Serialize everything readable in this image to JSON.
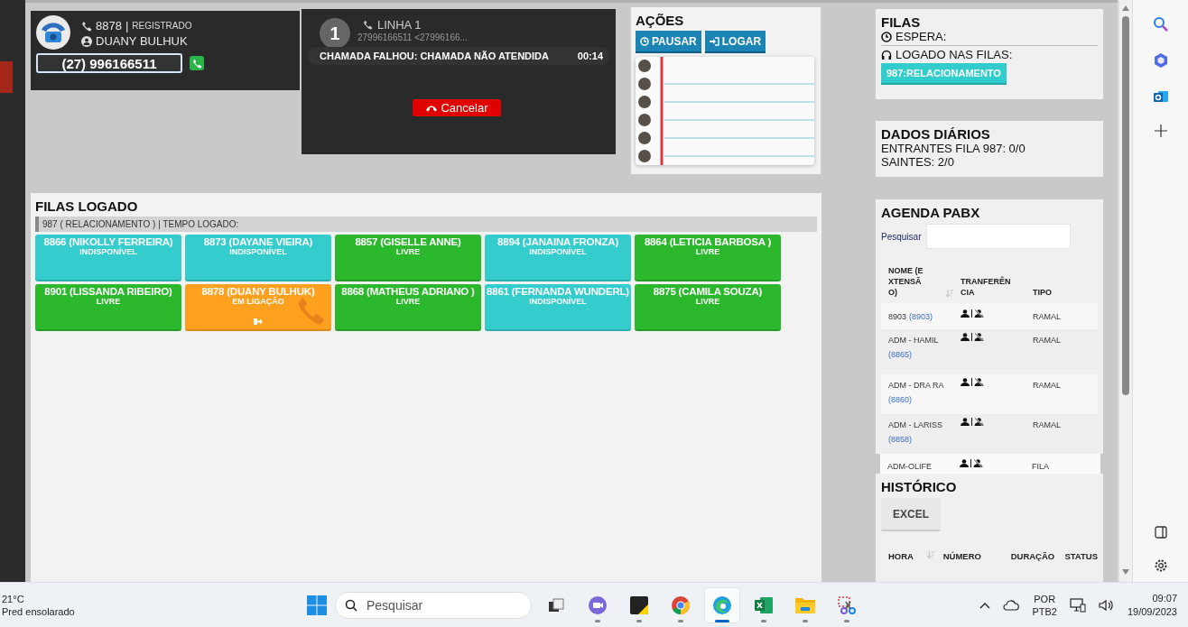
{
  "phone": {
    "extension": "8878",
    "separator": "|",
    "reg_status": "REGISTRADO",
    "user": "DUANY BULHUK",
    "dial_value": "(27) 996166511"
  },
  "call": {
    "line_number": "1",
    "line_label": "LINHA 1",
    "caller": "27996166511 <27996166...",
    "status": "CHAMADA FALHOU: CHAMADA NÃO ATENDIDA",
    "duration": "00:14",
    "cancel": "Cancelar"
  },
  "actions": {
    "title": "AÇÕES",
    "buttons": [
      {
        "kind": "pause",
        "label": "PAUSAR"
      },
      {
        "kind": "login",
        "label": "LOGAR"
      }
    ]
  },
  "queues": {
    "title": "FILAS",
    "waiting": "ESPERA:",
    "logged": "LOGADO NAS FILAS:",
    "tags": [
      "987:RELACIONAMENTO"
    ]
  },
  "daily": {
    "title": "DADOS DIÁRIOS",
    "lines": [
      "ENTRANTES FILA 987: 0/0",
      "SAINTES: 2/0"
    ]
  },
  "queue_panel": {
    "title": "FILAS LOGADO",
    "subheader": "987 ( RELACIONAMENTO ) | TEMPO LOGADO:",
    "agents": [
      {
        "name": "8866 (NIKOLLY FERREIRA)",
        "status": "INDISPONÍVEL",
        "kind": "unavailable"
      },
      {
        "name": "8873 (DAYANE VIEIRA)",
        "status": "INDISPONÍVEL",
        "kind": "unavailable"
      },
      {
        "name": "8857 (GISELLE ANNE)",
        "status": "LIVRE",
        "kind": "free"
      },
      {
        "name": "8894 (JANAINA FRONZA)",
        "status": "INDISPONÍVEL",
        "kind": "unavailable"
      },
      {
        "name": "8864 (LETICIA BARBOSA )",
        "status": "LIVRE",
        "kind": "free"
      },
      {
        "name": "8901 (LISSANDA RIBEIRO)",
        "status": "LIVRE",
        "kind": "free"
      },
      {
        "name": "8878 (DUANY BULHUK)",
        "status": "EM LIGAÇÃO",
        "kind": "in_call"
      },
      {
        "name": "8868 (MATHEUS ADRIANO )",
        "status": "LIVRE",
        "kind": "free"
      },
      {
        "name": "8861 (FERNANDA WUNDERL)",
        "status": "INDISPONÍVEL",
        "kind": "unavailable"
      },
      {
        "name": "8875 (CAMILA SOUZA)",
        "status": "LIVRE",
        "kind": "free"
      }
    ]
  },
  "agenda": {
    "title": "AGENDA PABX",
    "search_label": "Pesquisar",
    "columns": [
      "NOME (EXTENSÃO)",
      "TRANFERÊNCIA",
      "TIPO"
    ],
    "rows": [
      {
        "name": "8903",
        "ext": "(8903)",
        "type": "RAMAL"
      },
      {
        "name": "ADM - HAMIL",
        "ext": "(8865)",
        "type": "RAMAL"
      },
      {
        "name": "ADM - DRA RA",
        "ext": "(8860)",
        "type": "RAMAL"
      },
      {
        "name": "ADM - LARISS",
        "ext": "(8858)",
        "type": "RAMAL"
      }
    ],
    "overflow_row": {
      "name": "ADM-OLIFE",
      "type": "FILA"
    }
  },
  "history": {
    "title": "HISTÓRICO",
    "excel": "EXCEL",
    "columns": [
      "HORA",
      "NÚMERO",
      "DURAÇÃO",
      "STATUS"
    ]
  },
  "taskbar": {
    "temperature": "21°C",
    "weather": "Pred ensolarado",
    "search_placeholder": "Pesquisar",
    "apps": [
      {
        "kind": "taskview",
        "running": false,
        "selected": false
      },
      {
        "kind": "teams",
        "running": true,
        "selected": false
      },
      {
        "kind": "notes",
        "running": true,
        "selected": false
      },
      {
        "kind": "chrome",
        "running": true,
        "selected": false
      },
      {
        "kind": "edge",
        "running": true,
        "selected": true
      },
      {
        "kind": "excel",
        "running": true,
        "selected": false
      },
      {
        "kind": "folder",
        "running": true,
        "selected": false
      },
      {
        "kind": "snip",
        "running": true,
        "selected": false
      }
    ],
    "lang": "POR",
    "layout": "PTB2",
    "time": "09:07",
    "date": "19/09/2023"
  }
}
